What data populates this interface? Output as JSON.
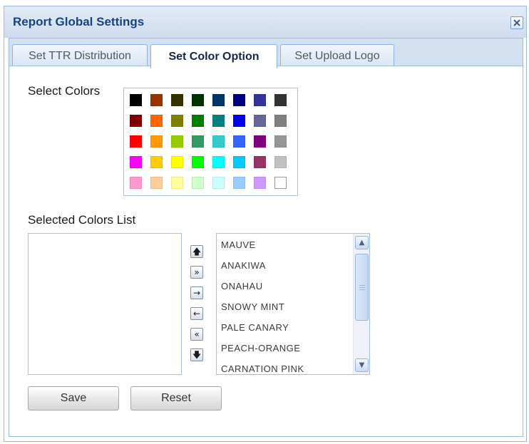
{
  "dialog": {
    "title": "Report Global Settings",
    "close_icon": "close-icon"
  },
  "tabs": [
    {
      "label": "Set TTR Distribution",
      "active": false
    },
    {
      "label": "Set Color Option",
      "active": true
    },
    {
      "label": "Set Upload Logo",
      "active": false
    }
  ],
  "color_panel": {
    "select_label": "Select Colors",
    "palette": [
      [
        "#000000",
        "#993300",
        "#333300",
        "#003300",
        "#003366",
        "#000080",
        "#333399",
        "#333333"
      ],
      [
        "#800000",
        "#FF6600",
        "#808000",
        "#008000",
        "#008080",
        "#0000FF",
        "#666699",
        "#808080"
      ],
      [
        "#FF0000",
        "#FF9900",
        "#99CC00",
        "#339966",
        "#33CCCC",
        "#3366FF",
        "#800080",
        "#969696"
      ],
      [
        "#FF00FF",
        "#FFCC00",
        "#FFFF00",
        "#00FF00",
        "#00FFFF",
        "#00CCFF",
        "#993366",
        "#C0C0C0"
      ],
      [
        "#FF99CC",
        "#FFCC99",
        "#FFFF99",
        "#CCFFCC",
        "#CCFFFF",
        "#99CCFF",
        "#CC99FF",
        "#FFFFFF"
      ]
    ]
  },
  "selected_list": {
    "label": "Selected Colors List",
    "items": []
  },
  "move_buttons": [
    {
      "icon": "move-up-icon",
      "glyph": "🡅"
    },
    {
      "icon": "move-all-right-icon",
      "glyph": "»"
    },
    {
      "icon": "move-right-icon",
      "glyph": "→"
    },
    {
      "icon": "move-left-icon",
      "glyph": "←"
    },
    {
      "icon": "move-all-left-icon",
      "glyph": "«"
    },
    {
      "icon": "move-down-icon",
      "glyph": "🡇"
    }
  ],
  "available_list": {
    "items": [
      "MAUVE",
      "ANAKIWA",
      "ONAHAU",
      "SNOWY MINT",
      "PALE CANARY",
      "PEACH-ORANGE",
      "CARNATION PINK"
    ],
    "scroll_up_icon": "scroll-up-icon",
    "scroll_down_icon": "scroll-down-icon"
  },
  "actions": {
    "save_label": "Save",
    "reset_label": "Reset"
  }
}
